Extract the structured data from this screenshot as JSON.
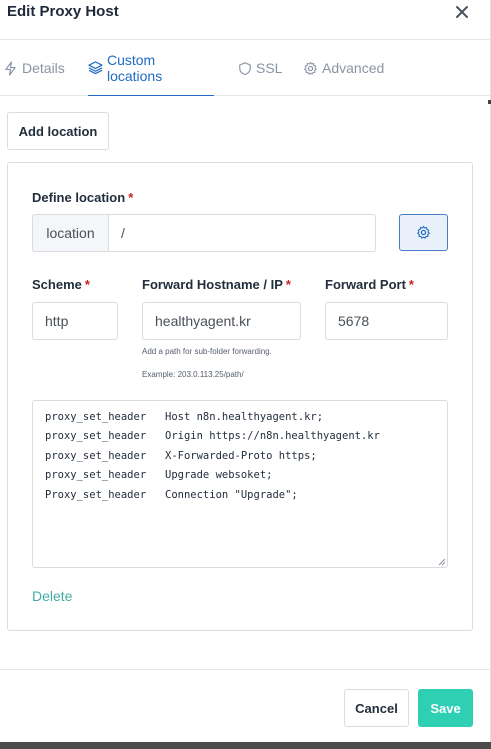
{
  "modal": {
    "title": "Edit Proxy Host",
    "close_icon": "close-icon"
  },
  "tabs": [
    {
      "label": "Details",
      "icon": "bolt-icon",
      "active": false
    },
    {
      "label": "Custom locations",
      "icon": "layers-icon",
      "active": true
    },
    {
      "label": "SSL",
      "icon": "shield-icon",
      "active": false
    },
    {
      "label": "Advanced",
      "icon": "gear-icon",
      "active": false
    }
  ],
  "add_location_label": "Add location",
  "location": {
    "define_label": "Define location",
    "required_mark": "*",
    "addon": "location",
    "value": "/",
    "settings_icon": "gear-icon"
  },
  "scheme": {
    "label": "Scheme",
    "value": "http"
  },
  "forward_host": {
    "label": "Forward Hostname / IP",
    "value": "healthyagent.kr",
    "hint_line1": "Add a path for sub-folder forwarding.",
    "hint_line2": "Example: 203.0.113.25/path/"
  },
  "forward_port": {
    "label": "Forward Port",
    "value": "5678"
  },
  "config_lines": [
    {
      "directive": "proxy_set_header",
      "value": "Host n8n.healthyagent.kr;"
    },
    {
      "directive": "proxy_set_header",
      "value": "Origin https://n8n.healthyagent.kr"
    },
    {
      "directive": "proxy_set_header",
      "value": "X-Forwarded-Proto https;"
    },
    {
      "directive": "proxy_set_header",
      "value": "Upgrade websoket;"
    },
    {
      "directive": "Proxy_set_header",
      "value": "Connection \"Upgrade\";"
    }
  ],
  "delete_label": "Delete",
  "footer": {
    "cancel_label": "Cancel",
    "save_label": "Save"
  },
  "colors": {
    "primary": "#206bc4",
    "save": "#2fcfb4",
    "delete": "#45aaa6",
    "required": "#cd201f"
  }
}
